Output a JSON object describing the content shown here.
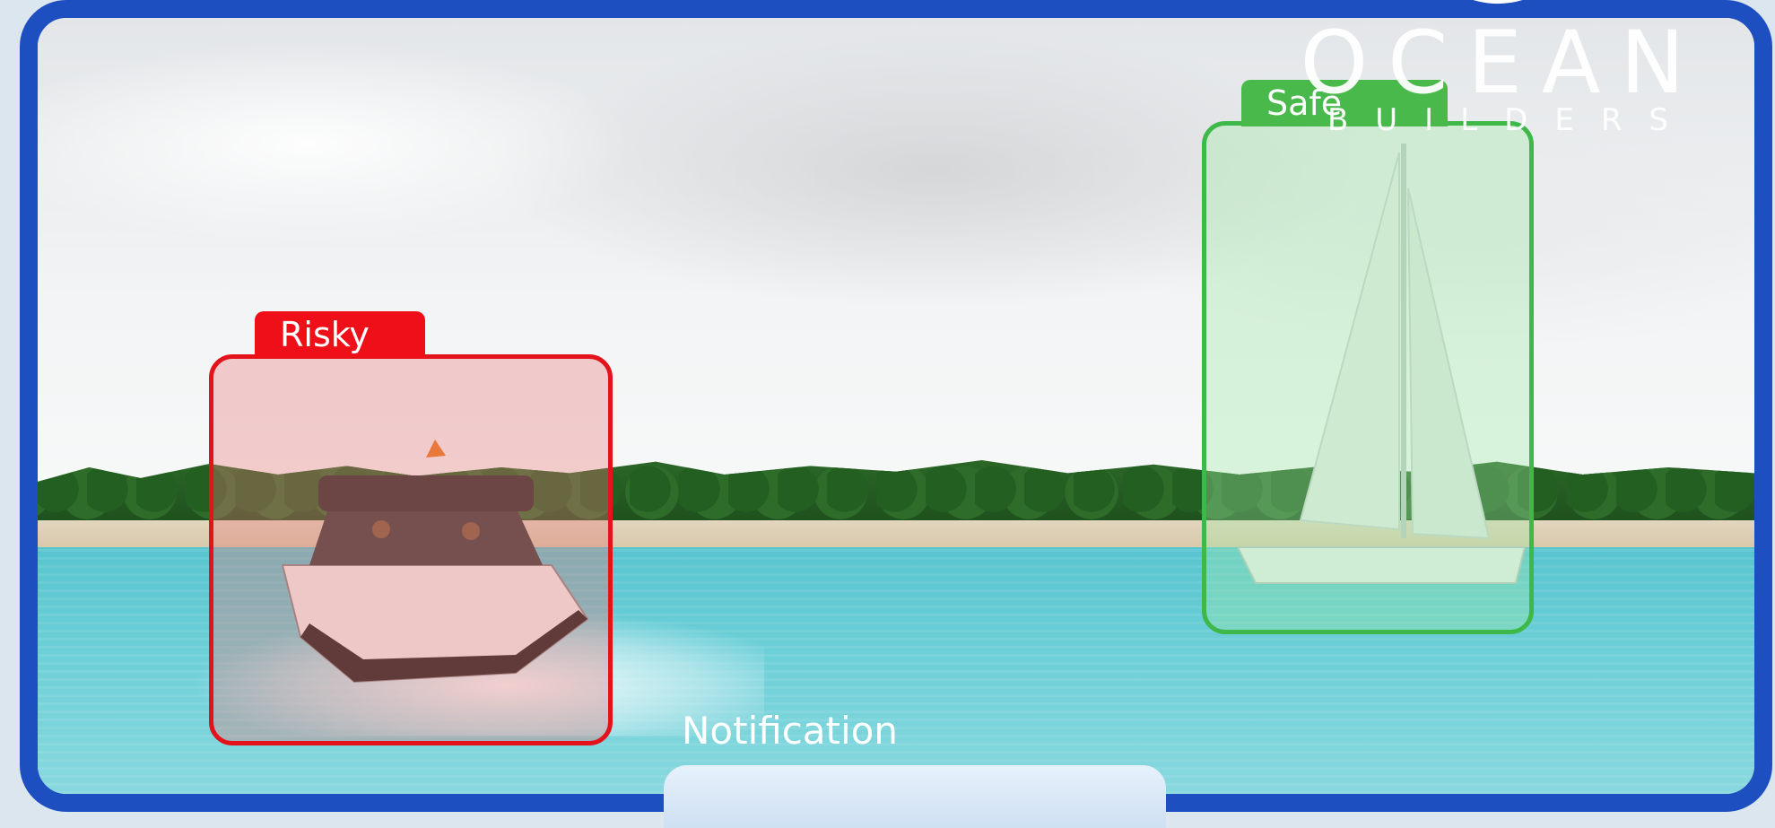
{
  "detections": [
    {
      "id": "risky",
      "label": "Risky",
      "color": "#e3121b"
    },
    {
      "id": "safe",
      "label": "Safe",
      "color": "#3fb84a"
    }
  ],
  "logo": {
    "main": "OCEAN",
    "sub": "BUILDERS"
  },
  "notification": {
    "label": "Notification"
  },
  "colors": {
    "frame": "#1e4fc0",
    "risky": "#e3121b",
    "safe": "#3fb84a"
  }
}
